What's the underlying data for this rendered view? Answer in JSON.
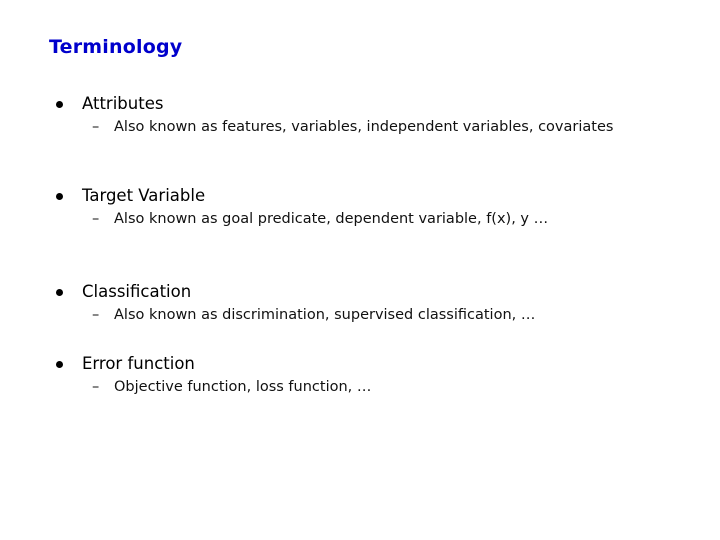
{
  "title": "Terminology",
  "title_color": "#0000cc",
  "bullets": [
    {
      "label": "Attributes",
      "sub": [
        {
          "dash": "–",
          "text": "Also known as features, variables, independent variables, covariates"
        }
      ]
    },
    {
      "label": "Target Variable",
      "sub": [
        {
          "dash": "–",
          "text": "Also known as goal predicate, dependent variable, f(x), y …"
        }
      ]
    },
    {
      "label": "Classification",
      "sub": [
        {
          "dash": "–",
          "text": "Also known as discrimination, supervised classification, …"
        }
      ]
    },
    {
      "label": "Error function",
      "sub": [
        {
          "dash": "–",
          "text": "Objective function, loss function, …"
        }
      ]
    }
  ]
}
